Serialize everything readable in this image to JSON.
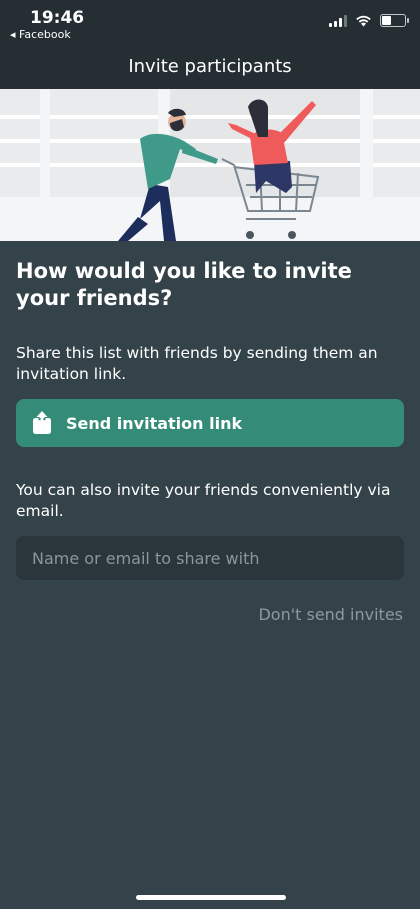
{
  "status_bar": {
    "time": "19:46",
    "back_app": "◂ Facebook",
    "icons": [
      "signal-icon",
      "wifi-icon",
      "battery-icon"
    ]
  },
  "header": {
    "title": "Invite participants"
  },
  "hero": {
    "illustration": "friends-shopping-cart-illustration"
  },
  "main": {
    "heading": "How would you like to invite your friends?",
    "link_description": "Share this list with friends by sending them an invitation link.",
    "send_button_label": "Send invitation link",
    "send_button_icon": "share-icon",
    "email_description": "You can also invite your friends conveniently via email.",
    "email_placeholder": "Name or email to share with",
    "email_value": "",
    "skip_label": "Don't send invites"
  },
  "colors": {
    "background": "#34434a",
    "topbar": "#252e33",
    "accent": "#348b77",
    "input": "#2a363c",
    "muted_text": "#8e989d"
  }
}
